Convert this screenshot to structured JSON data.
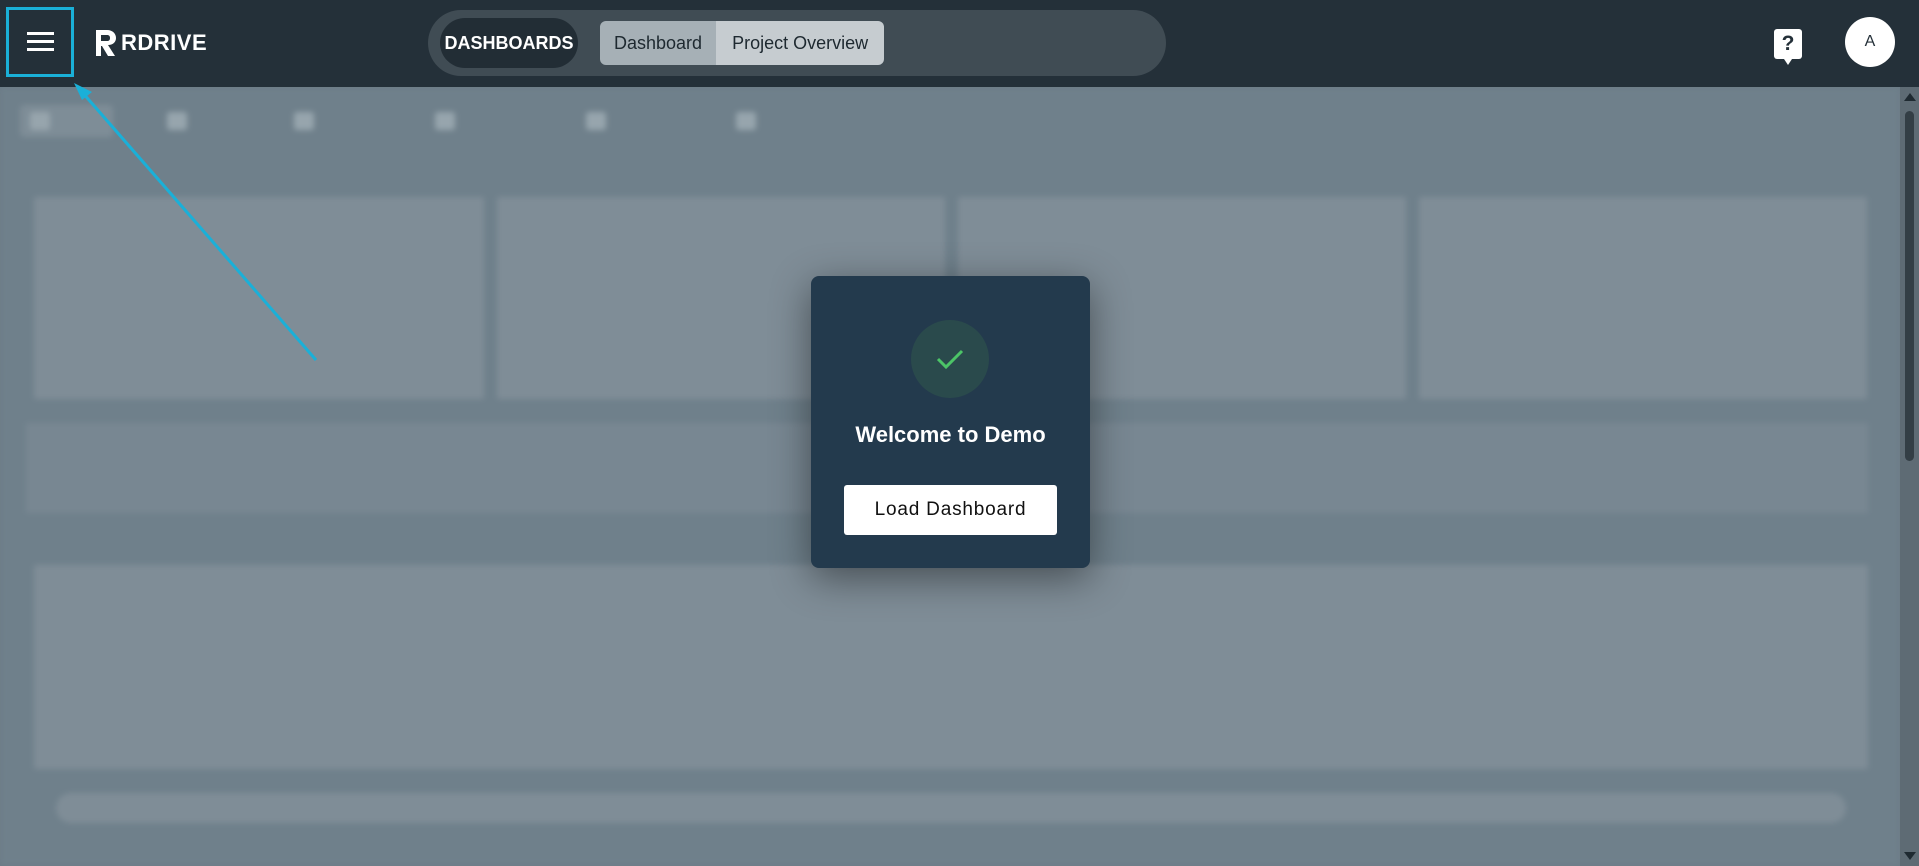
{
  "topbar": {
    "menu_icon": "hamburger-menu-icon",
    "logo_text": "RDRIVE",
    "dashboards_label": "DASHBOARDS",
    "segments": [
      {
        "label": "Dashboard"
      },
      {
        "label": "Project Overview"
      }
    ],
    "help_icon": "help-question-icon",
    "help_glyph": "?",
    "avatar_initial": "A"
  },
  "modal": {
    "icon": "check-icon",
    "title": "Welcome to Demo",
    "button_label": "Load Dashboard"
  },
  "colors": {
    "topbar_bg": "#243039",
    "highlight_box": "#1ab0d8",
    "annotation_arrow": "#1ab0d8",
    "modal_bg": "#233a4d",
    "check_green": "#4cc467",
    "overlay_bg": "#6f808b"
  }
}
